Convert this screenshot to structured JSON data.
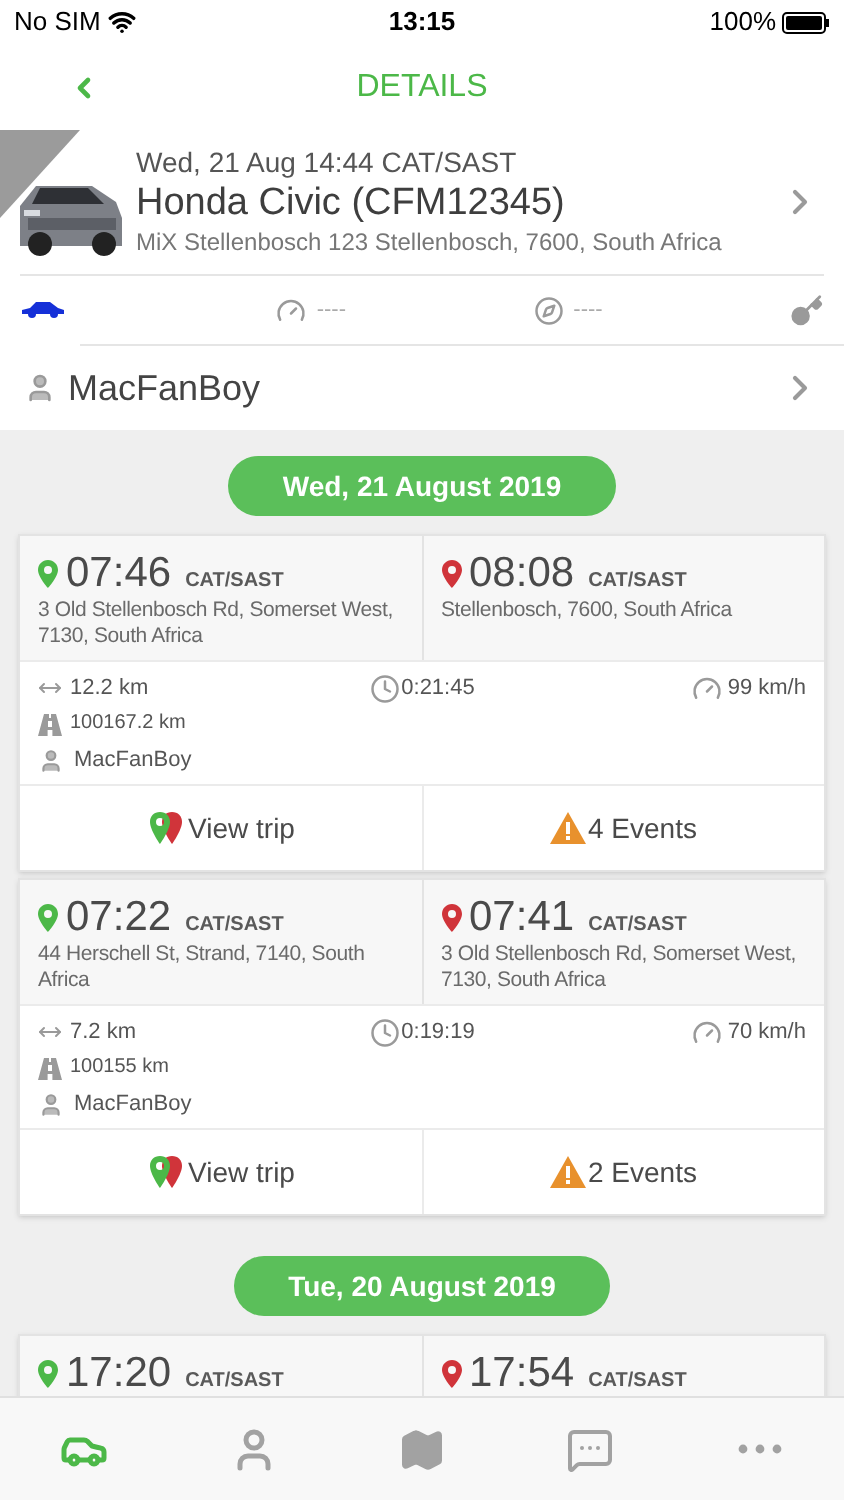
{
  "status_bar": {
    "carrier": "No SIM",
    "time": "13:15",
    "battery": "100%"
  },
  "nav": {
    "title": "DETAILS"
  },
  "vehicle": {
    "timestamp": "Wed, 21 Aug 14:44 CAT/SAST",
    "name": "Honda Civic (CFM12345)",
    "address": "MiX Stellenbosch 123 Stellenbosch, 7600, South Africa"
  },
  "vehicle_stats": [
    {
      "kind": "car"
    },
    {
      "kind": "speed",
      "value": "----"
    },
    {
      "kind": "heading",
      "value": "----"
    },
    {
      "kind": "ignition"
    }
  ],
  "driver": {
    "name": "MacFanBoy"
  },
  "sections": [
    {
      "date": "Wed, 21 August 2019",
      "trips": [
        {
          "start": {
            "time": "07:46",
            "zone": "CAT/SAST",
            "address": "3 Old Stellenbosch Rd, Somerset West, 7130, South Africa"
          },
          "end": {
            "time": "08:08",
            "zone": "CAT/SAST",
            "address": "Stellenbosch, 7600, South Africa"
          },
          "distance": "12.2 km",
          "duration": "0:21:45",
          "max_speed": "99 km/h",
          "odometer": "100167.2 km",
          "driver": "MacFanBoy",
          "view": "View trip",
          "events": "4 Events"
        },
        {
          "start": {
            "time": "07:22",
            "zone": "CAT/SAST",
            "address": "44 Herschell St, Strand, 7140, South Africa"
          },
          "end": {
            "time": "07:41",
            "zone": "CAT/SAST",
            "address": "3 Old Stellenbosch Rd, Somerset West, 7130, South Africa"
          },
          "distance": "7.2 km",
          "duration": "0:19:19",
          "max_speed": "70 km/h",
          "odometer": "100155 km",
          "driver": "MacFanBoy",
          "view": "View trip",
          "events": "2 Events"
        }
      ]
    },
    {
      "date": "Tue, 20 August 2019",
      "trips": [
        {
          "start": {
            "time": "17:20",
            "zone": "CAT/SAST"
          },
          "end": {
            "time": "17:54",
            "zone": "CAT/SAST"
          }
        }
      ]
    }
  ],
  "tab_bar": [
    {
      "kind": "vehicles",
      "selected": true
    },
    {
      "kind": "drivers",
      "selected": false
    },
    {
      "kind": "map",
      "selected": false
    },
    {
      "kind": "messages",
      "selected": false
    },
    {
      "kind": "more",
      "selected": false
    }
  ]
}
